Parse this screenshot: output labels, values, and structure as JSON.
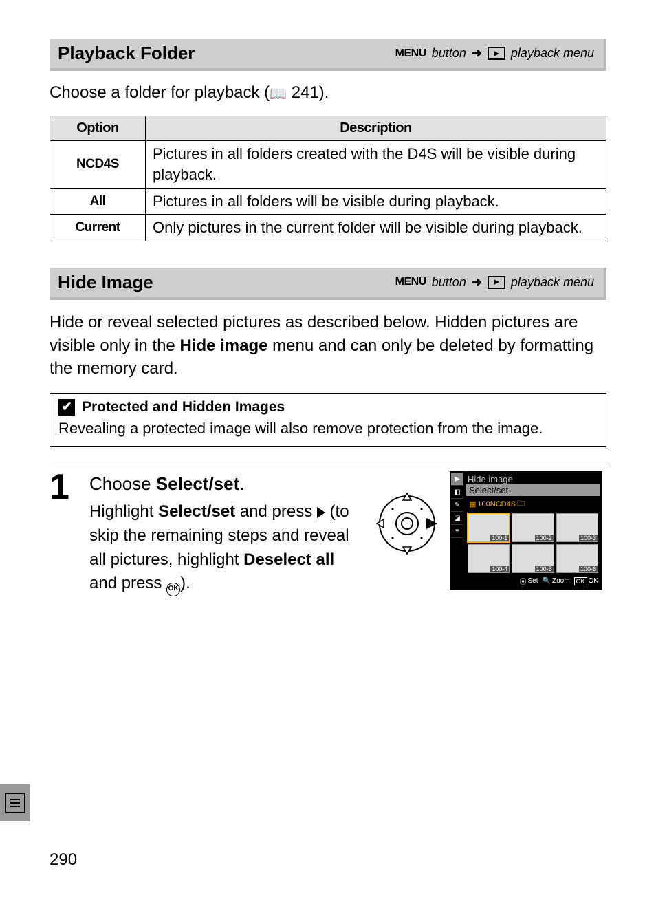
{
  "section1": {
    "title": "Playback Folder",
    "menu_label": "MENU",
    "button_word": "button",
    "path_target": "playback menu",
    "intro_prefix": "Choose a folder for playback (",
    "intro_pageref": "241",
    "intro_suffix": ")."
  },
  "table": {
    "head_option": "Option",
    "head_desc": "Description",
    "rows": [
      {
        "opt": "NCD4S",
        "desc": "Pictures in all folders created with the D4S will be visible during playback."
      },
      {
        "opt": "All",
        "desc": "Pictures in all folders will be visible during playback."
      },
      {
        "opt": "Current",
        "desc": "Only pictures in the current folder will be visible during playback."
      }
    ]
  },
  "section2": {
    "title": "Hide Image",
    "menu_label": "MENU",
    "button_word": "button",
    "path_target": "playback menu",
    "intro_a": "Hide or reveal selected pictures as described below.  Hidden pictures are visible only in the ",
    "intro_bold": "Hide image",
    "intro_b": " menu and can only be deleted by formatting the memory card."
  },
  "note": {
    "title": "Protected and Hidden Images",
    "body": "Revealing a protected image will also remove protection from the image."
  },
  "step1": {
    "num": "1",
    "head_a": "Choose ",
    "head_bold": "Select/set",
    "head_b": ".",
    "body_a": "Highlight ",
    "body_bold1": "Select/set",
    "body_b": " and press ",
    "body_c": " (to skip the remaining steps and reveal all pictures, highlight ",
    "body_bold2": "Deselect all",
    "body_d": " and press ",
    "body_e": ")."
  },
  "camera_screen": {
    "title": "Hide image",
    "subtitle": "Select/set",
    "folder": "100NCD4S",
    "thumbs": [
      "100-1",
      "100-2",
      "100-3",
      "100-4",
      "100-5",
      "100-6"
    ],
    "foot_set": "Set",
    "foot_zoom": "Zoom",
    "foot_ok_box": "OK",
    "foot_ok": "OK"
  },
  "page_number": "290"
}
